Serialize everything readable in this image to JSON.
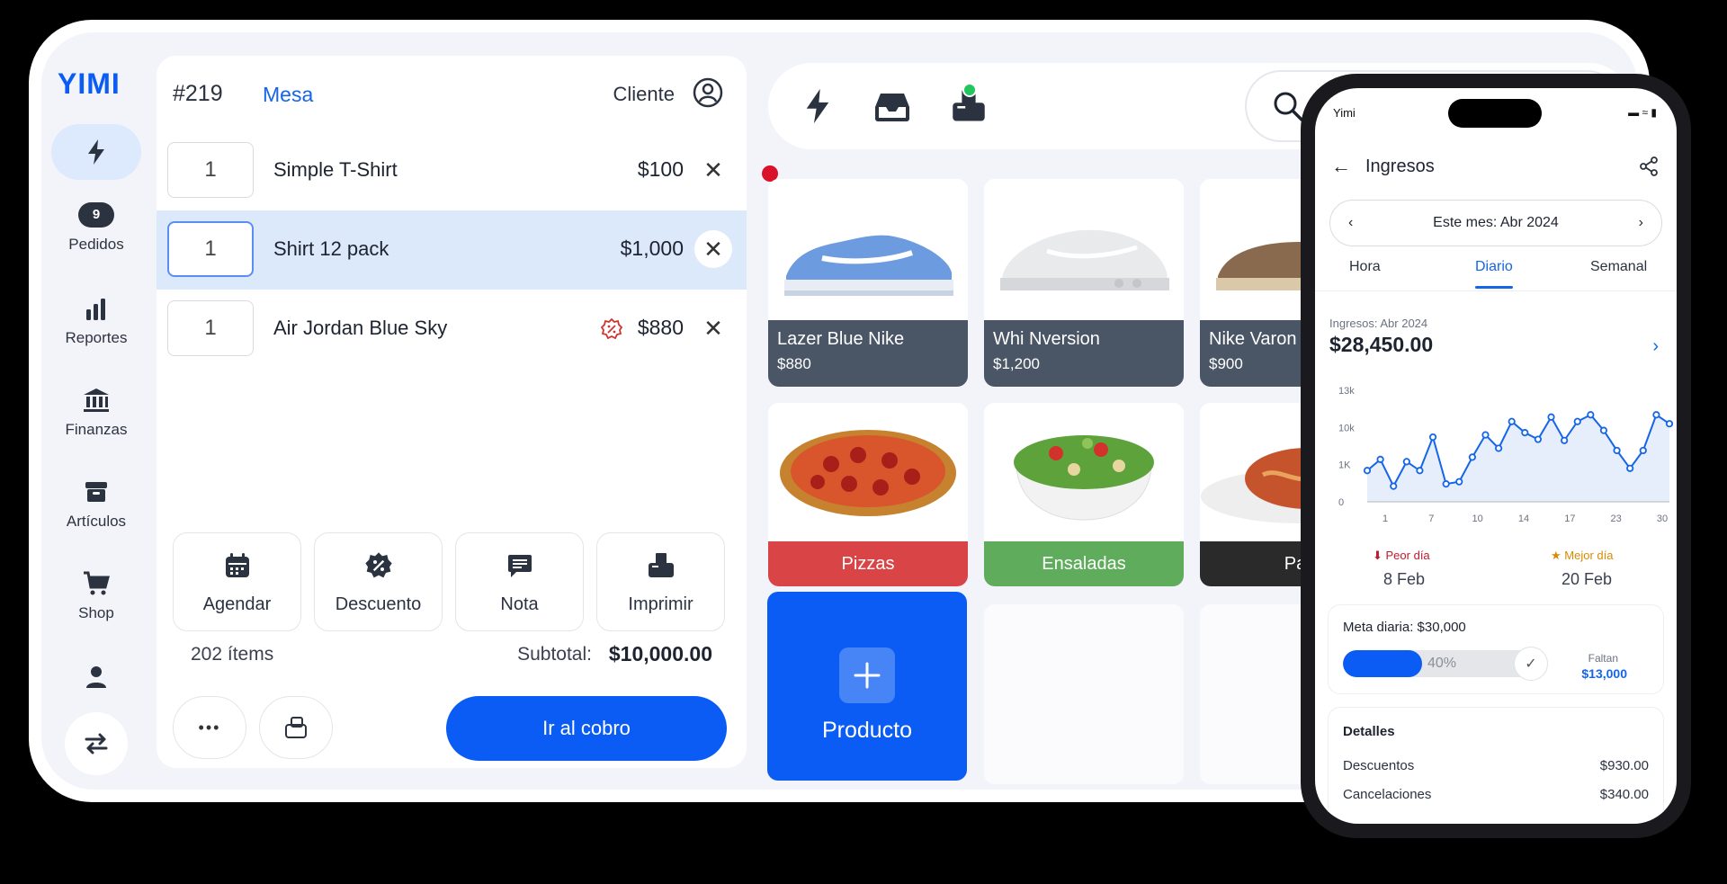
{
  "brand": {
    "logo": "YIMI",
    "accent": "#0a5cf5"
  },
  "sidebar": {
    "items": [
      {
        "label": "Pedidos",
        "badge": "9",
        "icon": "orders-badge"
      },
      {
        "label": "Reportes",
        "icon": "bar-chart-icon"
      },
      {
        "label": "Finanzas",
        "icon": "bank-icon"
      },
      {
        "label": "Artículos",
        "icon": "archive-icon"
      },
      {
        "label": "Shop",
        "icon": "cart-icon"
      }
    ]
  },
  "order": {
    "number": "#219",
    "mesa": "Mesa",
    "cliente": "Cliente",
    "lines": [
      {
        "qty": "1",
        "name": "Simple T-Shirt",
        "price": "$100"
      },
      {
        "qty": "1",
        "name": "Shirt 12 pack",
        "price": "$1,000"
      },
      {
        "qty": "1",
        "name": "Air Jordan Blue Sky",
        "price": "$880"
      }
    ],
    "actions": [
      "Agendar",
      "Descuento",
      "Nota",
      "Imprimir"
    ],
    "items_count": "202 ítems",
    "subtotal_label": "Subtotal:",
    "subtotal_value": "$10,000.00",
    "more_label": "•••",
    "pay_label": "Ir al cobro"
  },
  "products": [
    {
      "name": "Lazer Blue Nike",
      "price": "$880"
    },
    {
      "name": "Whi Nversion",
      "price": "$1,200"
    },
    {
      "name": "Nike Varon",
      "price": "$900"
    }
  ],
  "categories": [
    {
      "name": "Pizzas",
      "color": "#d94447"
    },
    {
      "name": "Ensaladas",
      "color": "#5fad5c"
    },
    {
      "name": "Pas",
      "color": "#2a2a2a"
    }
  ],
  "add_product": "Producto",
  "phone": {
    "carrier": "Yimi",
    "title": "Ingresos",
    "month": "Este mes: Abr 2024",
    "tabs": [
      "Hora",
      "Diario",
      "Semanal"
    ],
    "active_tab": "Diario",
    "income_label": "Ingresos: Abr 2024",
    "income_value": "$28,450.00",
    "chart_data": {
      "type": "area",
      "y_tick_labels": [
        "13k",
        "10k",
        "1K",
        "0"
      ],
      "x_tick_labels": [
        "1",
        "7",
        "10",
        "14",
        "17",
        "23",
        "30"
      ],
      "grid": false,
      "values": [
        0.28,
        0.38,
        0.14,
        0.36,
        0.28,
        0.58,
        0.16,
        0.18,
        0.4,
        0.6,
        0.48,
        0.72,
        0.62,
        0.56,
        0.76,
        0.55,
        0.72,
        0.78,
        0.64,
        0.46,
        0.3,
        0.46,
        0.78,
        0.7
      ],
      "series_color": "#1565e8",
      "fill_color": "#e6eefc"
    },
    "worst_label": "Peor día",
    "worst_value": "8 Feb",
    "best_label": "Mejor día",
    "best_value": "20 Feb",
    "goal_label": "Meta diaria: $30,000",
    "goal_progress": 0.4,
    "goal_pct_text": "40%",
    "faltan_label": "Faltan",
    "faltan_value": "$13,000",
    "details_title": "Detalles",
    "details": [
      {
        "label": "Descuentos",
        "value": "$930.00"
      },
      {
        "label": "Cancelaciones",
        "value": "$340.00"
      }
    ]
  }
}
